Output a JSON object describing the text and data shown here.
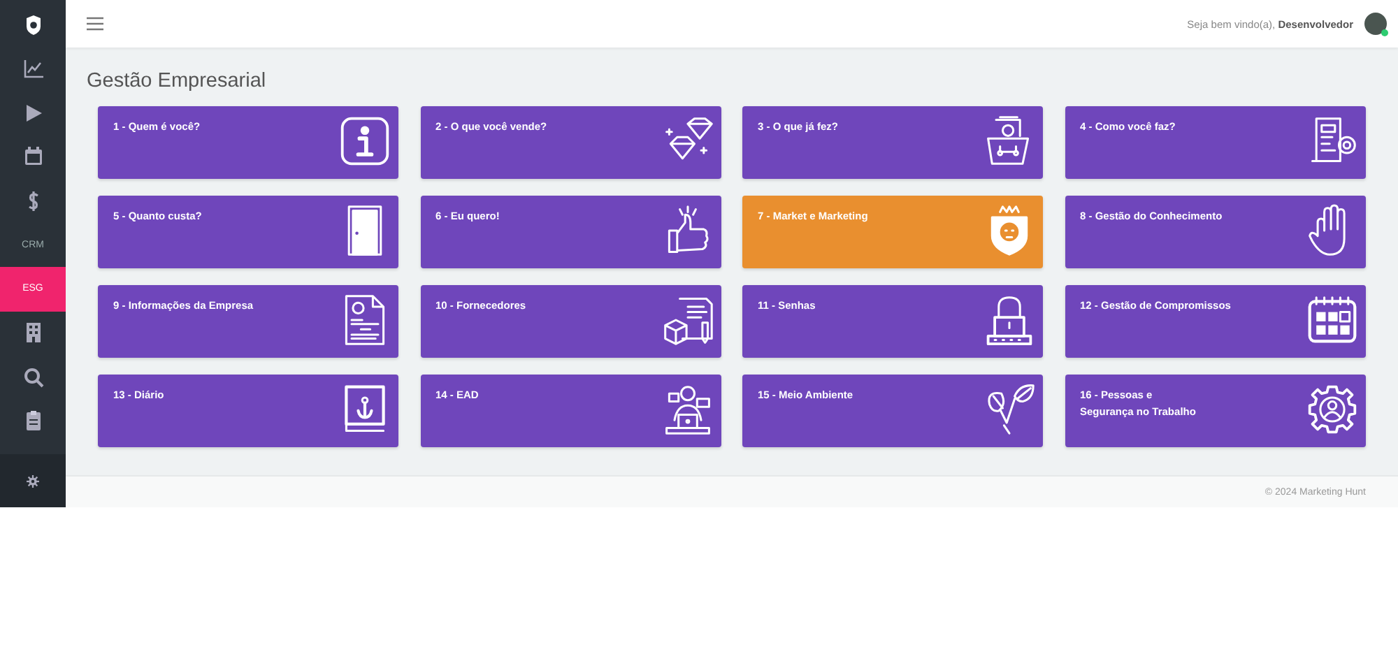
{
  "sidebar": {
    "items": [
      {
        "kind": "logo",
        "selected": false
      },
      {
        "kind": "icon",
        "selected": false
      },
      {
        "kind": "icon",
        "selected": false
      },
      {
        "kind": "icon",
        "selected": false
      },
      {
        "kind": "icon",
        "selected": false
      },
      {
        "kind": "text",
        "label": "CRM",
        "selected": false
      },
      {
        "kind": "text",
        "label": "ESG",
        "selected": true
      },
      {
        "kind": "icon",
        "selected": false
      },
      {
        "kind": "icon",
        "selected": false
      },
      {
        "kind": "icon",
        "selected": false
      }
    ]
  },
  "header": {
    "greeting": "Seja bem vindo(a),",
    "user": "Desenvolvedor",
    "online": true
  },
  "page_title": "Gestão Empresarial",
  "tiles": [
    {
      "lines": [
        "1 - Quem é você?"
      ],
      "color": "#6f46bb"
    },
    {
      "lines": [
        "2 - O que você vende?"
      ],
      "color": "#6f46bb"
    },
    {
      "lines": [
        "3 - O que já fez?"
      ],
      "color": "#6f46bb"
    },
    {
      "lines": [
        "4 - Como você faz?"
      ],
      "color": "#6f46bb"
    },
    {
      "lines": [
        "5 - Quanto custa?"
      ],
      "color": "#6f46bb"
    },
    {
      "lines": [
        "6 - Eu quero!"
      ],
      "color": "#6f46bb"
    },
    {
      "lines": [
        "7 - Market e Marketing"
      ],
      "color": "#e98f2f"
    },
    {
      "lines": [
        "8 - Gestão do Conhecimento"
      ],
      "color": "#6f46bb"
    },
    {
      "lines": [
        "9 - Informações da Empresa"
      ],
      "color": "#6f46bb"
    },
    {
      "lines": [
        "10 - Fornecedores"
      ],
      "color": "#6f46bb"
    },
    {
      "lines": [
        "11 - Senhas"
      ],
      "color": "#6f46bb"
    },
    {
      "lines": [
        "12 - Gestão de Compromissos"
      ],
      "color": "#6f46bb"
    },
    {
      "lines": [
        "13 - Diário"
      ],
      "color": "#6f46bb"
    },
    {
      "lines": [
        "14 - EAD"
      ],
      "color": "#6f46bb"
    },
    {
      "lines": [
        "15 - Meio Ambiente"
      ],
      "color": "#6f46bb"
    },
    {
      "lines": [
        "16 - Pessoas e",
        "Segurança no Trabalho"
      ],
      "color": "#6f46bb"
    }
  ],
  "footer": "© 2024 Marketing Hunt"
}
